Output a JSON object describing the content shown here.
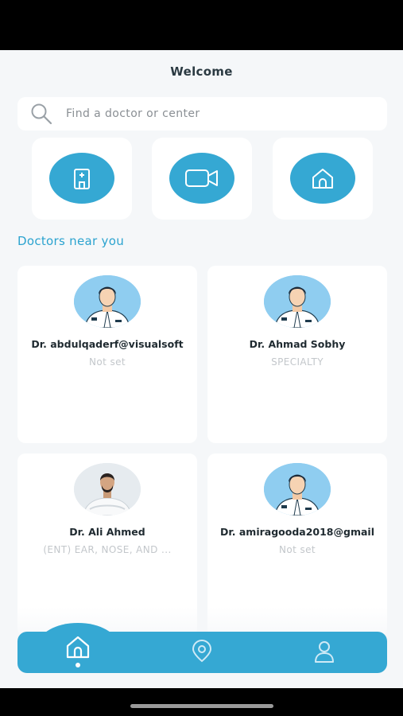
{
  "header": {
    "title": "Welcome"
  },
  "search": {
    "placeholder": "Find a doctor or center",
    "icon": "search-icon"
  },
  "quick_actions": [
    {
      "icon": "hospital-icon"
    },
    {
      "icon": "video-camera-icon"
    },
    {
      "icon": "home-icon"
    }
  ],
  "section": {
    "title": "Doctors near you"
  },
  "doctors": [
    {
      "name": "Dr. abdulqaderf@visualsoft",
      "specialty": "Not set",
      "avatar": "doctor-illustration"
    },
    {
      "name": "Dr. Ahmad Sobhy",
      "specialty": "SPECIALTY",
      "avatar": "doctor-illustration"
    },
    {
      "name": "Dr. Ali Ahmed",
      "specialty": "(ENT) EAR, NOSE, AND ...",
      "avatar": "doctor-photo"
    },
    {
      "name": "Dr. amiragooda2018@gmail",
      "specialty": "Not set",
      "avatar": "doctor-illustration"
    }
  ],
  "bottom_nav": [
    {
      "icon": "home-icon",
      "active": true
    },
    {
      "icon": "location-pin-icon",
      "active": false
    },
    {
      "icon": "profile-icon",
      "active": false
    }
  ],
  "colors": {
    "accent": "#35a8d3",
    "section_title": "#2ba3cf",
    "background": "#f5f7f9",
    "muted_text": "#c3c7cb"
  }
}
